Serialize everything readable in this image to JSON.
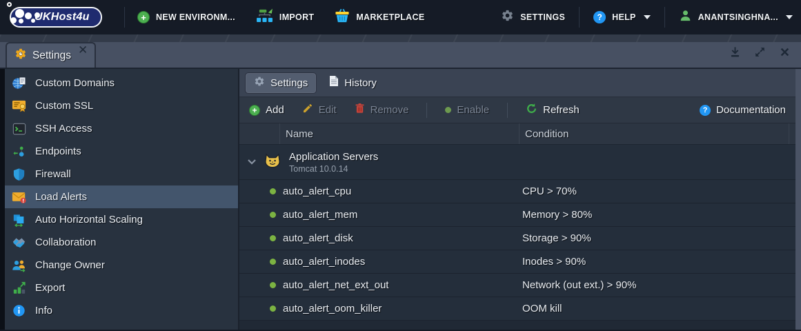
{
  "topbar": {
    "logo_text": "UKHost4u",
    "items": [
      {
        "label": "NEW ENVIRONM...",
        "icon": "plus-circle-icon"
      },
      {
        "label": "IMPORT",
        "icon": "import-icon"
      },
      {
        "label": "MARKETPLACE",
        "icon": "marketplace-icon"
      }
    ],
    "right": [
      {
        "label": "SETTINGS",
        "icon": "gear-icon"
      },
      {
        "label": "HELP",
        "icon": "help-icon"
      },
      {
        "label": "ANANTSINGHNA...",
        "icon": "user-icon"
      }
    ]
  },
  "window_tab": {
    "title": "Settings"
  },
  "sidebar": {
    "items": [
      {
        "label": "Custom Domains"
      },
      {
        "label": "Custom SSL"
      },
      {
        "label": "SSH Access"
      },
      {
        "label": "Endpoints"
      },
      {
        "label": "Firewall"
      },
      {
        "label": "Load Alerts"
      },
      {
        "label": "Auto Horizontal Scaling"
      },
      {
        "label": "Collaboration"
      },
      {
        "label": "Change Owner"
      },
      {
        "label": "Export"
      },
      {
        "label": "Info"
      }
    ]
  },
  "panel": {
    "tabs": [
      {
        "label": "Settings"
      },
      {
        "label": "History"
      }
    ],
    "toolbar": {
      "add": "Add",
      "edit": "Edit",
      "remove": "Remove",
      "enable": "Enable",
      "refresh": "Refresh",
      "documentation": "Documentation"
    },
    "table": {
      "columns": {
        "name": "Name",
        "condition": "Condition"
      },
      "group": {
        "name": "Application Servers",
        "subtitle": "Tomcat 10.0.14"
      },
      "rows": [
        {
          "name": "auto_alert_cpu",
          "condition": "CPU > 70%"
        },
        {
          "name": "auto_alert_mem",
          "condition": "Memory > 80%"
        },
        {
          "name": "auto_alert_disk",
          "condition": "Storage > 90%"
        },
        {
          "name": "auto_alert_inodes",
          "condition": "Inodes > 90%"
        },
        {
          "name": "auto_alert_net_ext_out",
          "condition": "Network (out ext.) > 90%"
        },
        {
          "name": "auto_alert_oom_killer",
          "condition": "OOM kill"
        }
      ]
    }
  },
  "colors": {
    "status_green": "#7cb342",
    "accent_green": "#4caf50",
    "accent_blue": "#2196f3",
    "warning_yellow": "#f0ad2e",
    "alert_red": "#d9433b",
    "selected_bg": "#43556c",
    "brand_navy": "#1f2b6f"
  }
}
